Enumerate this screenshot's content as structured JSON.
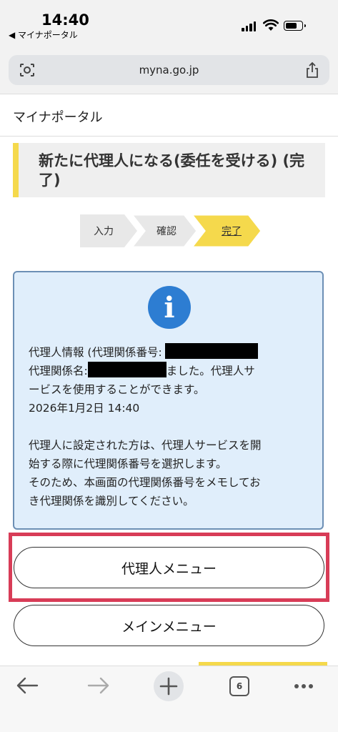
{
  "status_bar": {
    "time": "14:40",
    "back_app": "◀ マイナポータル"
  },
  "browser": {
    "url": "myna.go.jp",
    "tab_count": "6"
  },
  "site": {
    "title": "マイナポータル"
  },
  "page": {
    "heading": "新たに代理人になる(委任を受ける) (完了)",
    "steps": [
      {
        "label": "入力",
        "state": "done"
      },
      {
        "label": "確認",
        "state": "done"
      },
      {
        "label": "完了",
        "state": "active"
      }
    ]
  },
  "info": {
    "line1_prefix": "代理人情報 (代理関係番号:",
    "line2_prefix": "代理関係名:",
    "line2_suffix": "ました。代理人サ",
    "line3": "ービスを使用することができます。",
    "datetime": "2026年1月2日 14:40",
    "note1": "代理人に設定された方は、代理人サービスを開",
    "note2": "始する際に代理関係番号を選択します。",
    "note3": "そのため、本画面の代理関係番号をメモしてお",
    "note4": "き代理関係を識別してください。"
  },
  "buttons": {
    "agent_menu": "代理人メニュー",
    "main_menu": "メインメニュー"
  },
  "colors": {
    "accent_yellow": "#f5d94c",
    "info_blue": "#2d7dd2",
    "highlight_red": "#d83c57"
  }
}
